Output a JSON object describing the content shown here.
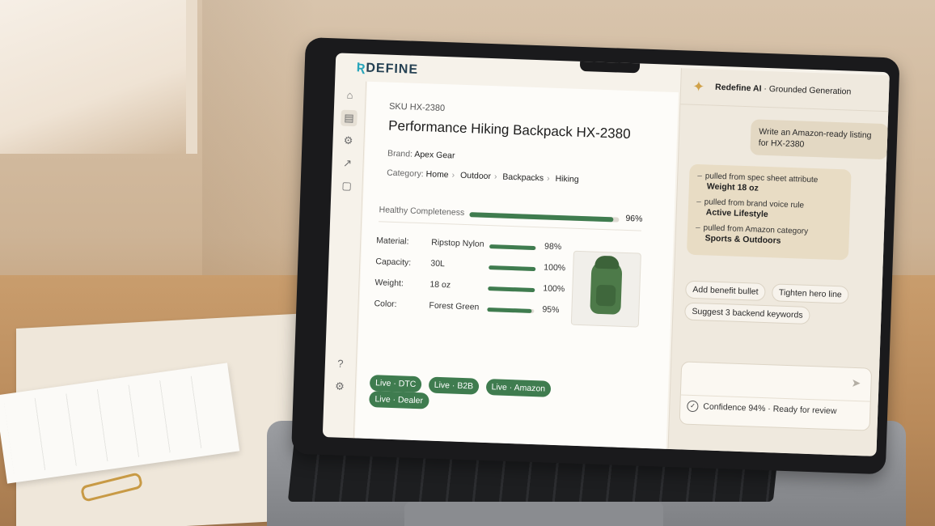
{
  "app": {
    "logo_mark": "Ʀ",
    "logo_text": "DEFINE"
  },
  "rail": {
    "icons": [
      "home-icon",
      "document-icon",
      "gear-icon",
      "trend-icon",
      "file-icon",
      "help-icon",
      "settings-icon"
    ]
  },
  "product": {
    "sku": "SKU HX-2380",
    "title": "Performance Hiking Backpack HX-2380",
    "brand_label": "Brand:",
    "brand_value": "Apex Gear",
    "category_label": "Category:",
    "breadcrumbs": [
      "Home",
      "Outdoor",
      "Backpacks",
      "Hiking"
    ],
    "completeness": {
      "label": "Healthy Completeness",
      "value": "96%",
      "fraction": 0.96
    },
    "attributes": [
      {
        "label": "Material:",
        "value": "Ripstop Nylon",
        "pct": "98%",
        "fraction": 0.98
      },
      {
        "label": "Capacity:",
        "value": "30L",
        "pct": "100%",
        "fraction": 1.0
      },
      {
        "label": "Weight:",
        "value": "18 oz",
        "pct": "100%",
        "fraction": 1.0
      },
      {
        "label": "Color:",
        "value": "Forest Green",
        "pct": "95%",
        "fraction": 0.95
      }
    ],
    "channels": [
      "Live · DTC",
      "Live · B2B",
      "Live · Amazon",
      "Live · Dealer"
    ]
  },
  "ai": {
    "title_bold": "Redefine AI",
    "title_rest": " · Grounded Generation",
    "user_message": "Write an Amazon-ready listing for HX-2380",
    "sources": [
      {
        "text": "pulled from spec sheet attribute",
        "value": "Weight 18 oz"
      },
      {
        "text": "pulled from brand voice rule",
        "value": "Active Lifestyle"
      },
      {
        "text": "pulled from Amazon category",
        "value": "Sports & Outdoors"
      }
    ],
    "chips": [
      "Add benefit bullet",
      "Tighten hero line",
      "Suggest 3 backend keywords"
    ],
    "composer_placeholder": "",
    "confidence": "Confidence 94% · Ready for review"
  },
  "colors": {
    "accent": "#3f7c4f",
    "brand": "#2aa6bb",
    "ai_bubble": "#e8dcc4"
  }
}
